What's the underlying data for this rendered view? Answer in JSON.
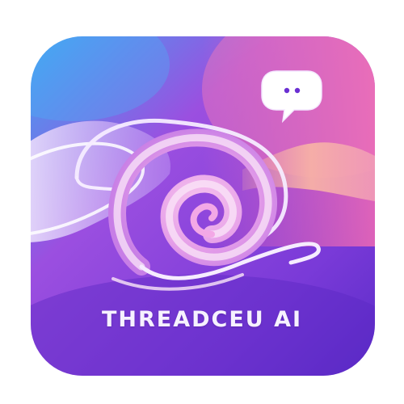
{
  "brand": {
    "name": "THREADCEU AI"
  },
  "icons": {
    "background": "rounded-square-icon",
    "emblem": "spiral-thread-icon",
    "chat": "speech-bubble-icon"
  },
  "colors": {
    "gradient_top_left": "#3fa6f2",
    "gradient_top_right": "#f06ab4",
    "gradient_mid": "#9b4fe0",
    "gradient_bottom": "#6a2fd2",
    "spiral_light": "#fbe7f8",
    "spiral_pink": "#e59ee8",
    "wave_peach": "#f7b1a6",
    "wave_lavender": "#d9c6f7",
    "wordmark": "#f6f1ff"
  }
}
